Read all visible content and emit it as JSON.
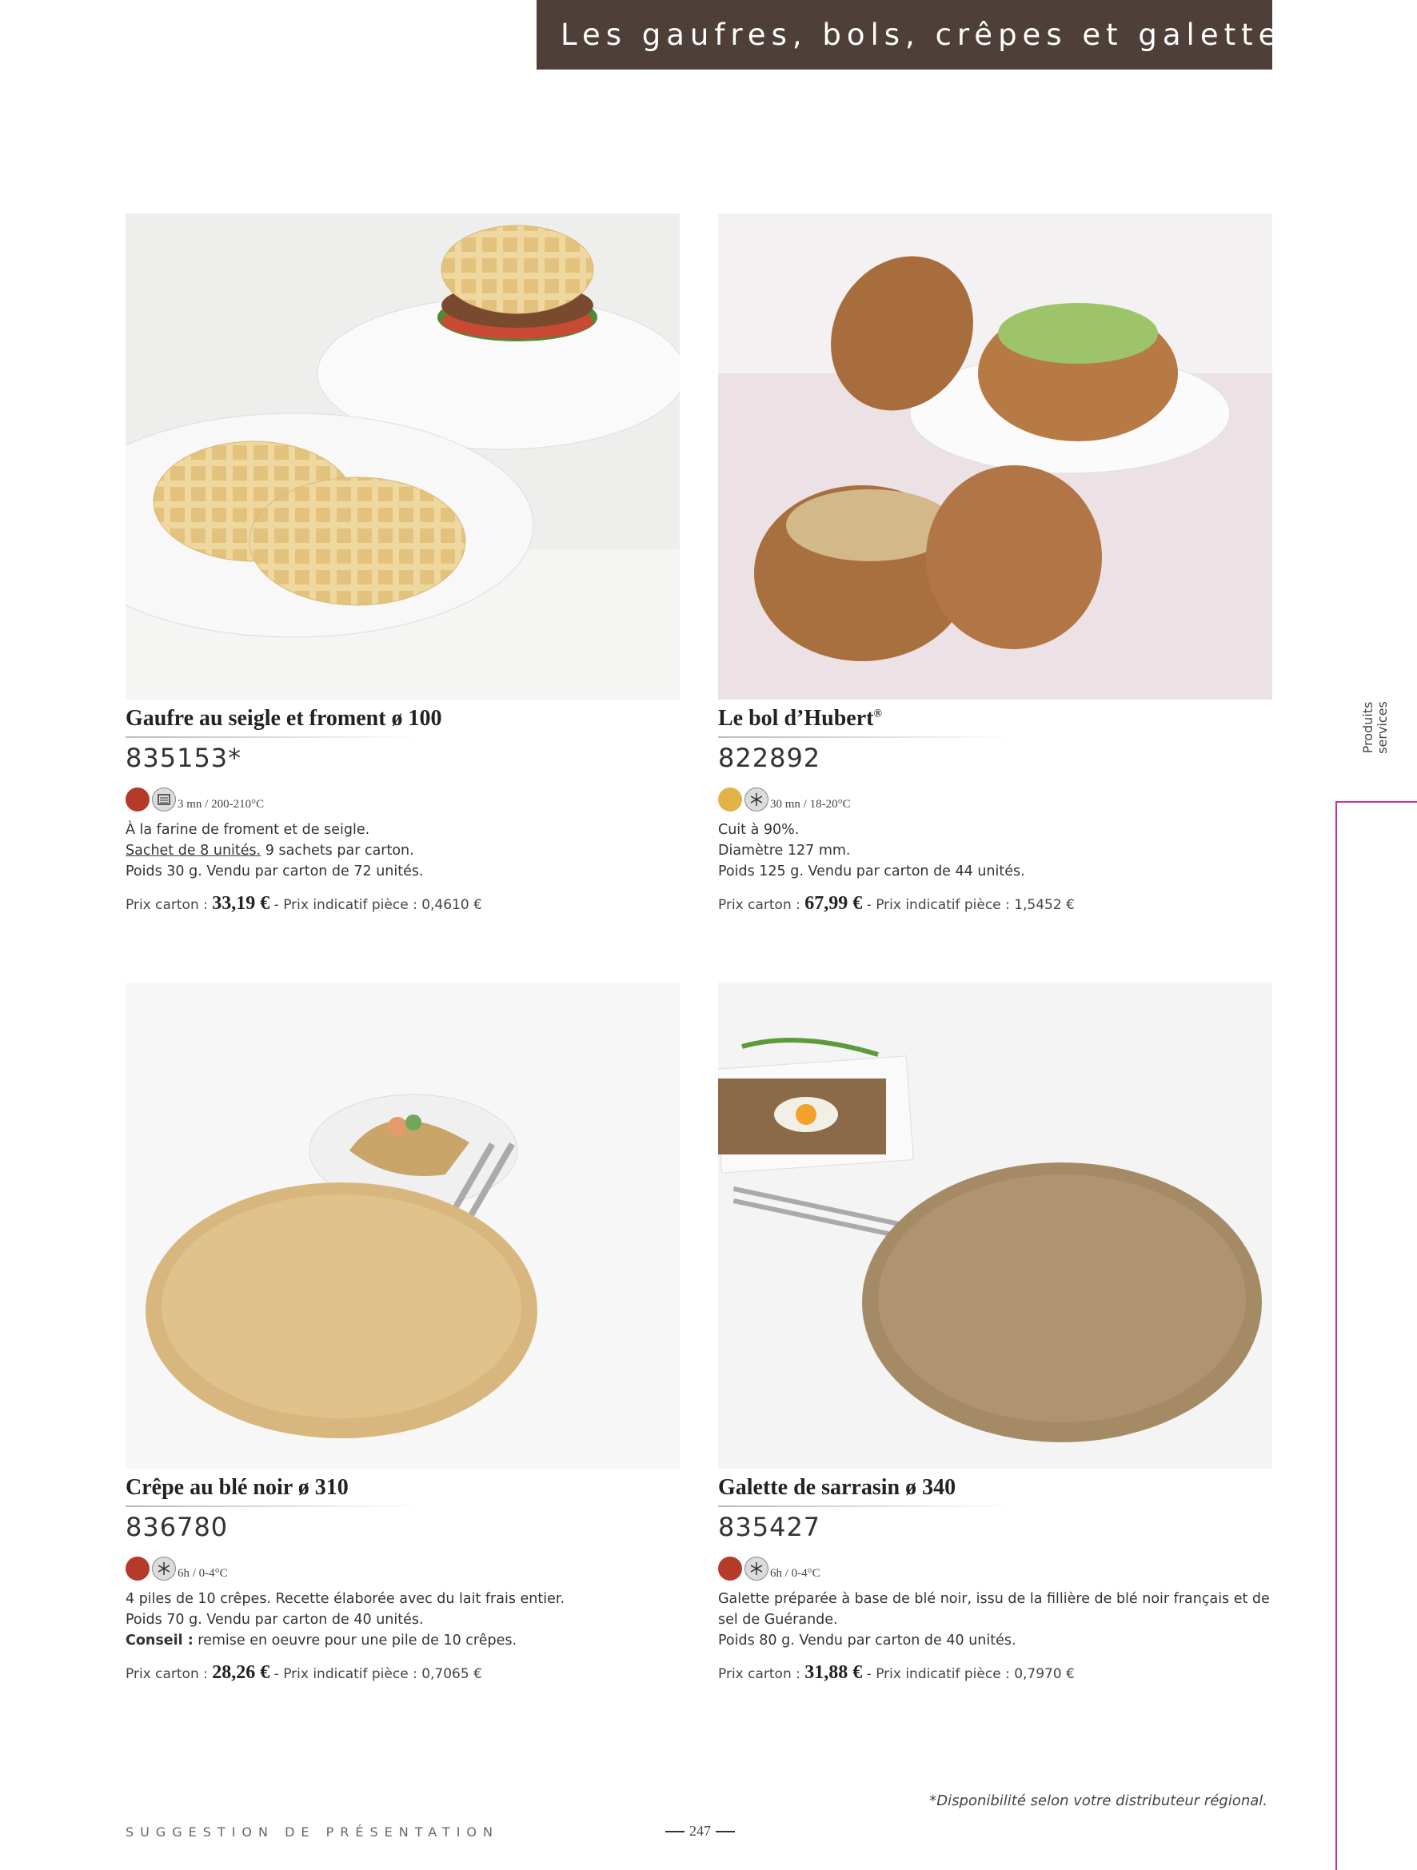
{
  "header": {
    "title": "Les gaufres, bols, crêpes et galettes"
  },
  "side_tab": {
    "line1": "Produits",
    "line2": "services"
  },
  "products": [
    {
      "name": "Gaufre au seigle et froment ø 100",
      "code": "835153*",
      "dot_color": "#b53a2a",
      "mode_icon": "oven-icon",
      "temp": "3 mn / 200-210°C",
      "desc_lines": [
        "À la farine de froment et de seigle."
      ],
      "sachet_underline": "Sachet de 8 unités.",
      "sachet_rest": " 9 sachets par carton.",
      "weight": "Poids 30 g. Vendu par carton de 72 unités.",
      "price_label": "Prix carton : ",
      "price": "33,19 €",
      "unit_price": " - Prix indicatif pièce : 0,4610 €"
    },
    {
      "name": "Le bol d’Hubert",
      "name_sup": "®",
      "code": "822892",
      "dot_color": "#e2b246",
      "mode_icon": "snowflake-icon",
      "temp": "30 mn / 18-20°C",
      "line1": "Cuit à 90%.",
      "line2": "Diamètre 127 mm.",
      "weight": "Poids 125 g. Vendu par carton de 44 unités.",
      "price_label": "Prix carton : ",
      "price": "67,99 €",
      "unit_price": " - Prix indicatif pièce : 1,5452 €"
    },
    {
      "name": "Crêpe au blé noir ø 310",
      "code": "836780",
      "dot_color": "#b53a2a",
      "mode_icon": "snowflake-icon",
      "temp": "6h / 0-4°C",
      "line1": "4 piles de 10 crêpes. Recette élaborée avec du lait frais entier.",
      "weight": "Poids 70 g. Vendu par carton de 40 unités.",
      "conseil_label": "Conseil :",
      "conseil_text": " remise en oeuvre pour une pile de 10 crêpes.",
      "price_label": "Prix carton : ",
      "price": "28,26 €",
      "unit_price": " - Prix indicatif pièce : 0,7065 €"
    },
    {
      "name": "Galette de sarrasin ø 340",
      "code": "835427",
      "dot_color": "#b53a2a",
      "mode_icon": "snowflake-icon",
      "temp": "6h / 0-4°C",
      "line1": "Galette préparée à base de blé noir, issu de la fillière de blé noir français et de sel de Guérande.",
      "weight": "Poids 80 g. Vendu par carton de 40 unités.",
      "price_label": "Prix carton : ",
      "price": "31,88 €",
      "unit_price": " - Prix indicatif pièce : 0,7970 €"
    }
  ],
  "footer": {
    "suggestion": "SUGGESTION DE PRÉSENTATION",
    "page": "247",
    "availability": "*Disponibilité selon votre distributeur régional."
  }
}
